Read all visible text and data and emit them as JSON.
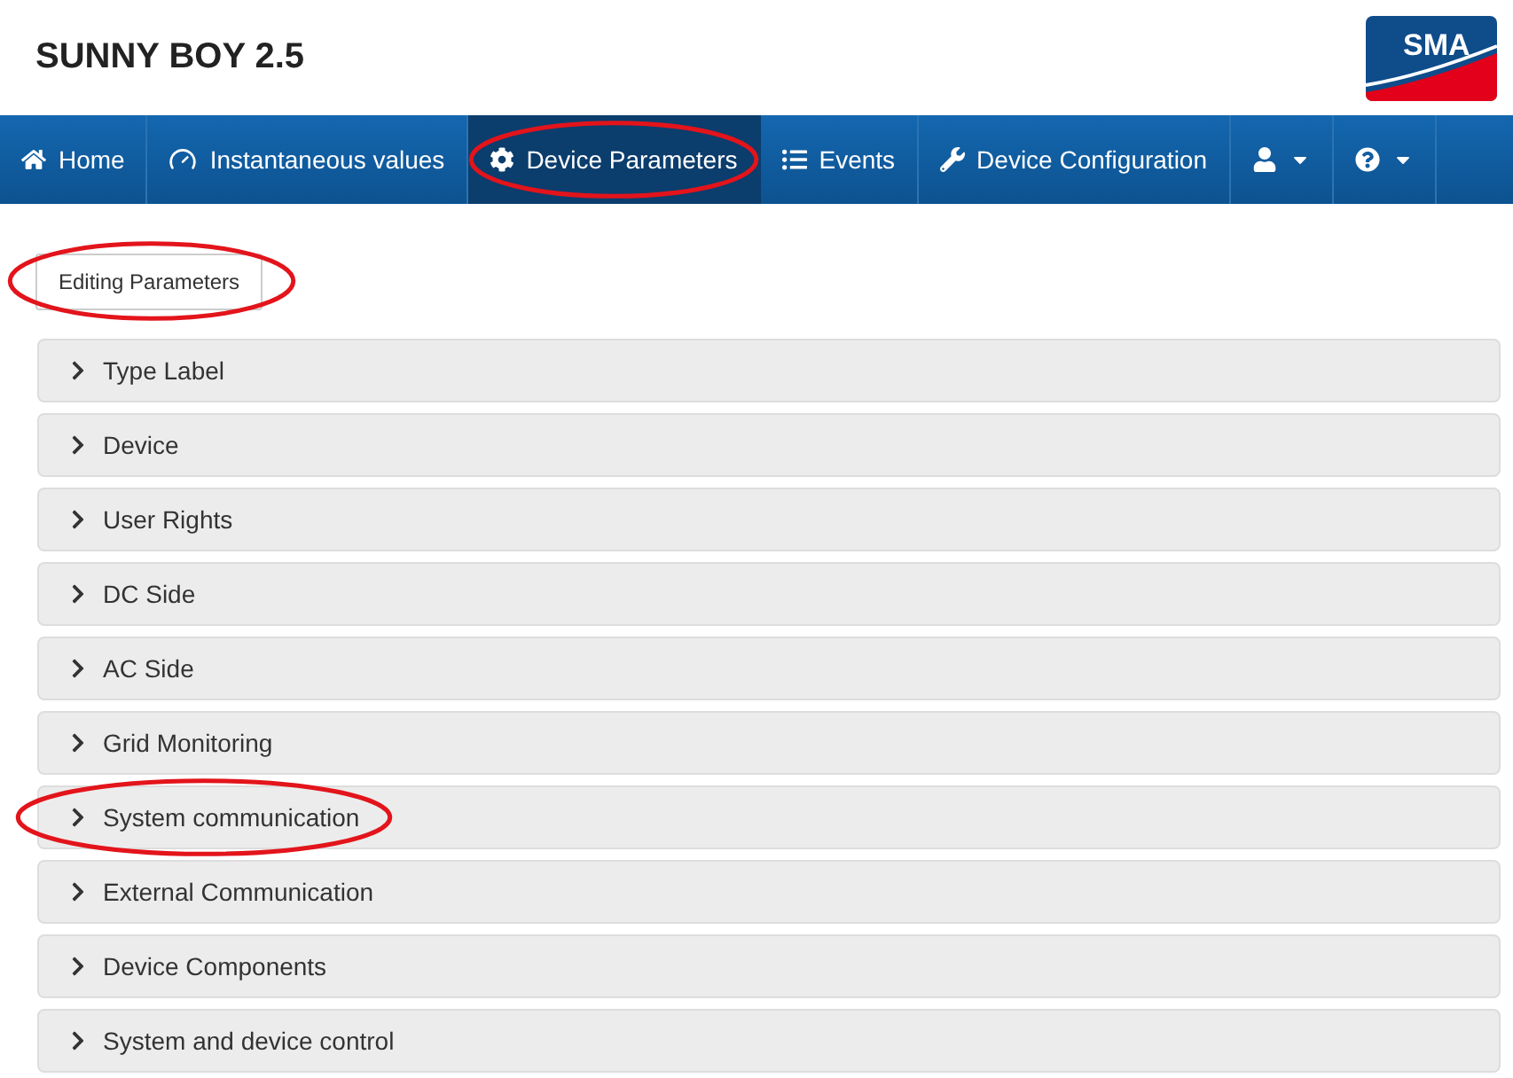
{
  "header": {
    "title": "SUNNY BOY 2.5",
    "logo": "SMA"
  },
  "nav": [
    {
      "kind": "home",
      "label": "Home",
      "selected": false,
      "highlighted": false
    },
    {
      "kind": "gauge",
      "label": "Instantaneous values",
      "selected": false,
      "highlighted": false
    },
    {
      "kind": "gear",
      "label": "Device Parameters",
      "selected": true,
      "highlighted": true
    },
    {
      "kind": "list",
      "label": "Events",
      "selected": false,
      "highlighted": false
    },
    {
      "kind": "wrench",
      "label": "Device Configuration",
      "selected": false,
      "highlighted": false
    },
    {
      "kind": "user",
      "selected": false,
      "highlighted": false
    },
    {
      "kind": "help",
      "selected": false,
      "highlighted": false
    }
  ],
  "edit_button": {
    "label": "Editing Parameters",
    "highlighted": true
  },
  "sections": [
    {
      "label": "Type Label",
      "expanded": false,
      "highlighted": false
    },
    {
      "label": "Device",
      "expanded": false,
      "highlighted": false
    },
    {
      "label": "User Rights",
      "expanded": false,
      "highlighted": false
    },
    {
      "label": "DC Side",
      "expanded": false,
      "highlighted": false
    },
    {
      "label": "AC Side",
      "expanded": false,
      "highlighted": false
    },
    {
      "label": "Grid Monitoring",
      "expanded": false,
      "highlighted": false
    },
    {
      "label": "System communication",
      "expanded": false,
      "highlighted": true
    },
    {
      "label": "External Communication",
      "expanded": false,
      "highlighted": false
    },
    {
      "label": "Device Components",
      "expanded": false,
      "highlighted": false
    },
    {
      "label": "System and device control",
      "expanded": false,
      "highlighted": false
    }
  ]
}
